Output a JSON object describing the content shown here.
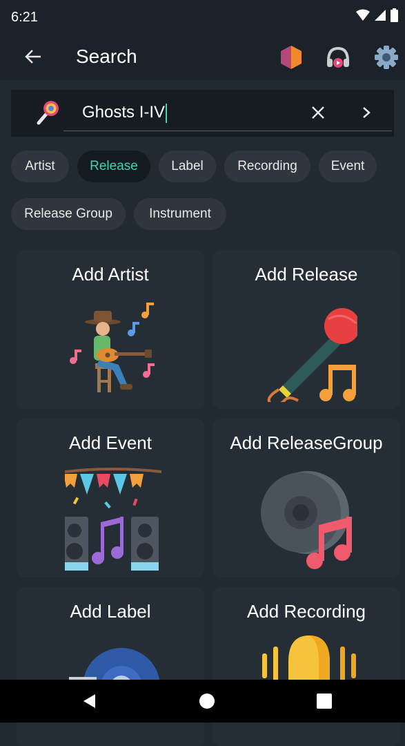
{
  "status_bar": {
    "time": "6:21"
  },
  "app_bar": {
    "title": "Search"
  },
  "search": {
    "query": "Ghosts I-IV"
  },
  "filters": [
    {
      "label": "Artist",
      "selected": false
    },
    {
      "label": "Release",
      "selected": true
    },
    {
      "label": "Label",
      "selected": false
    },
    {
      "label": "Recording",
      "selected": false
    },
    {
      "label": "Event",
      "selected": false
    },
    {
      "label": "Release Group",
      "selected": false
    },
    {
      "label": "Instrument",
      "selected": false
    }
  ],
  "cards": [
    {
      "label": "Add Artist",
      "icon": "guitar-player-icon"
    },
    {
      "label": "Add Release",
      "icon": "microphone-icon"
    },
    {
      "label": "Add Event",
      "icon": "concert-icon"
    },
    {
      "label": "Add ReleaseGroup",
      "icon": "vinyl-record-icon"
    },
    {
      "label": "Add Label",
      "icon": "record-label-icon"
    },
    {
      "label": "Add Recording",
      "icon": "recording-icon"
    }
  ],
  "colors": {
    "accent": "#3fd4b2",
    "background": "#222a31",
    "toolbar": "#1b2229",
    "chip": "#2f363d",
    "card": "#262e35"
  }
}
